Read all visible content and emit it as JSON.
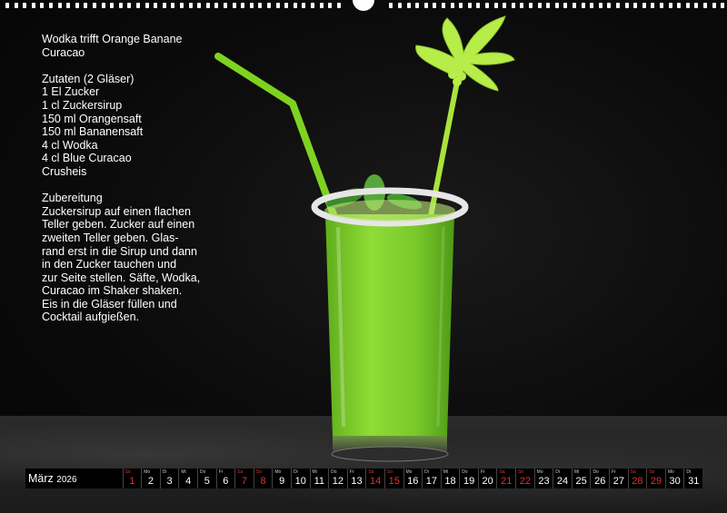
{
  "recipe": {
    "title_line1": "Wodka trifft Orange Banane",
    "title_line2": "Curacao",
    "ingredients_heading": "Zutaten (2 Gläser)",
    "ingredients": [
      "1 El Zucker",
      "1 cl Zuckersirup",
      "150 ml Orangensaft",
      "150 ml Bananensaft",
      "4 cl Wodka",
      "4 cl Blue Curacao",
      "Crusheis"
    ],
    "preparation_heading": "Zubereitung",
    "preparation_lines": [
      "Zuckersirup auf einen flachen",
      "Teller geben. Zucker auf einen",
      "zweiten Teller geben. Glas-",
      "rand erst in die Sirup und dann",
      "in den Zucker tauchen und",
      "zur Seite stellen. Säfte, Wodka,",
      "Curacao im Shaker shaken.",
      "Eis in die Gläser füllen und",
      "Cocktail aufgießen."
    ]
  },
  "calendar": {
    "month": "März",
    "year": "2026",
    "days": [
      {
        "wd": "So",
        "n": "1",
        "we": true
      },
      {
        "wd": "Mo",
        "n": "2"
      },
      {
        "wd": "Di",
        "n": "3"
      },
      {
        "wd": "Mi",
        "n": "4"
      },
      {
        "wd": "Do",
        "n": "5"
      },
      {
        "wd": "Fr",
        "n": "6"
      },
      {
        "wd": "Sa",
        "n": "7",
        "we": true
      },
      {
        "wd": "So",
        "n": "8",
        "we": true
      },
      {
        "wd": "Mo",
        "n": "9"
      },
      {
        "wd": "Di",
        "n": "10"
      },
      {
        "wd": "Mi",
        "n": "11"
      },
      {
        "wd": "Do",
        "n": "12"
      },
      {
        "wd": "Fr",
        "n": "13"
      },
      {
        "wd": "Sa",
        "n": "14",
        "we": true
      },
      {
        "wd": "So",
        "n": "15",
        "we": true
      },
      {
        "wd": "Mo",
        "n": "16"
      },
      {
        "wd": "Di",
        "n": "17"
      },
      {
        "wd": "Mi",
        "n": "18"
      },
      {
        "wd": "Do",
        "n": "19"
      },
      {
        "wd": "Fr",
        "n": "20"
      },
      {
        "wd": "Sa",
        "n": "21",
        "we": true
      },
      {
        "wd": "So",
        "n": "22",
        "we": true
      },
      {
        "wd": "Mo",
        "n": "23"
      },
      {
        "wd": "Di",
        "n": "24"
      },
      {
        "wd": "Mi",
        "n": "25"
      },
      {
        "wd": "Do",
        "n": "26"
      },
      {
        "wd": "Fr",
        "n": "27"
      },
      {
        "wd": "Sa",
        "n": "28",
        "we": true
      },
      {
        "wd": "So",
        "n": "29",
        "we": true
      },
      {
        "wd": "Mo",
        "n": "30"
      },
      {
        "wd": "Di",
        "n": "31"
      }
    ]
  },
  "colors": {
    "weekend": "#e03030",
    "drink": "#7fd42a",
    "straw": "#7ed321"
  }
}
